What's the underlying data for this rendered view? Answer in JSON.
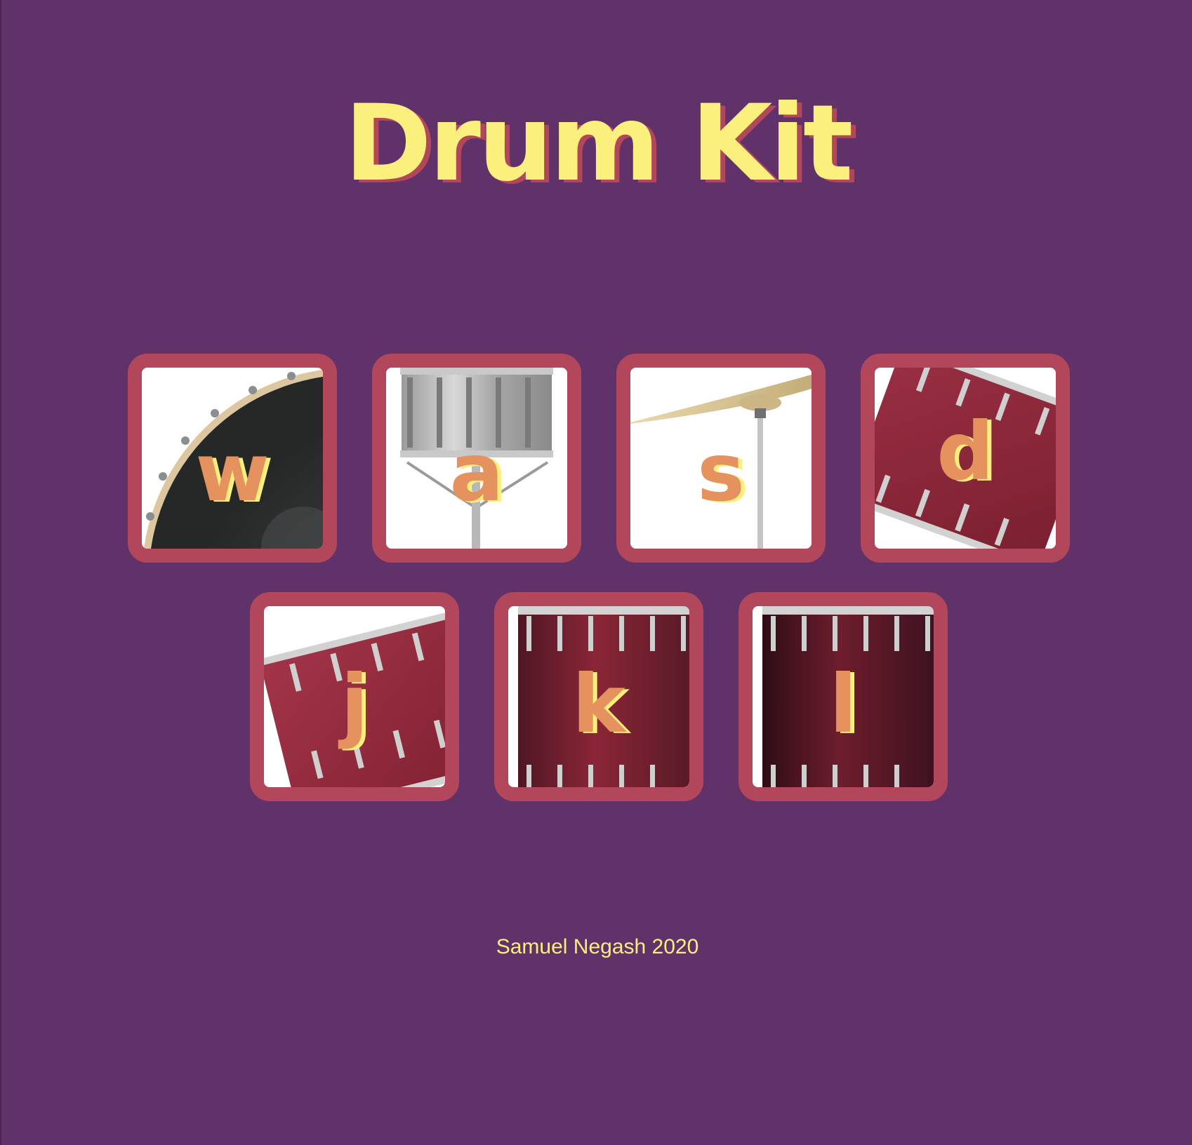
{
  "title": "Drum Kit",
  "drums": [
    {
      "key": "w",
      "icon": "bass-drum-icon"
    },
    {
      "key": "a",
      "icon": "snare-drum-icon"
    },
    {
      "key": "s",
      "icon": "cymbal-icon"
    },
    {
      "key": "d",
      "icon": "tom-drum-icon"
    },
    {
      "key": "j",
      "icon": "tom-drum-icon"
    },
    {
      "key": "k",
      "icon": "floor-tom-icon"
    },
    {
      "key": "l",
      "icon": "floor-tom-icon"
    }
  ],
  "footer": "Samuel Negash 2020",
  "colors": {
    "background": "#61316a",
    "title": "#fbf07d",
    "title_shadow": "#b2475c",
    "button_border": "#b2475c",
    "key_letter": "#e6925f",
    "key_shadow": "#fbf07d",
    "footer_text": "#fbf07d"
  }
}
